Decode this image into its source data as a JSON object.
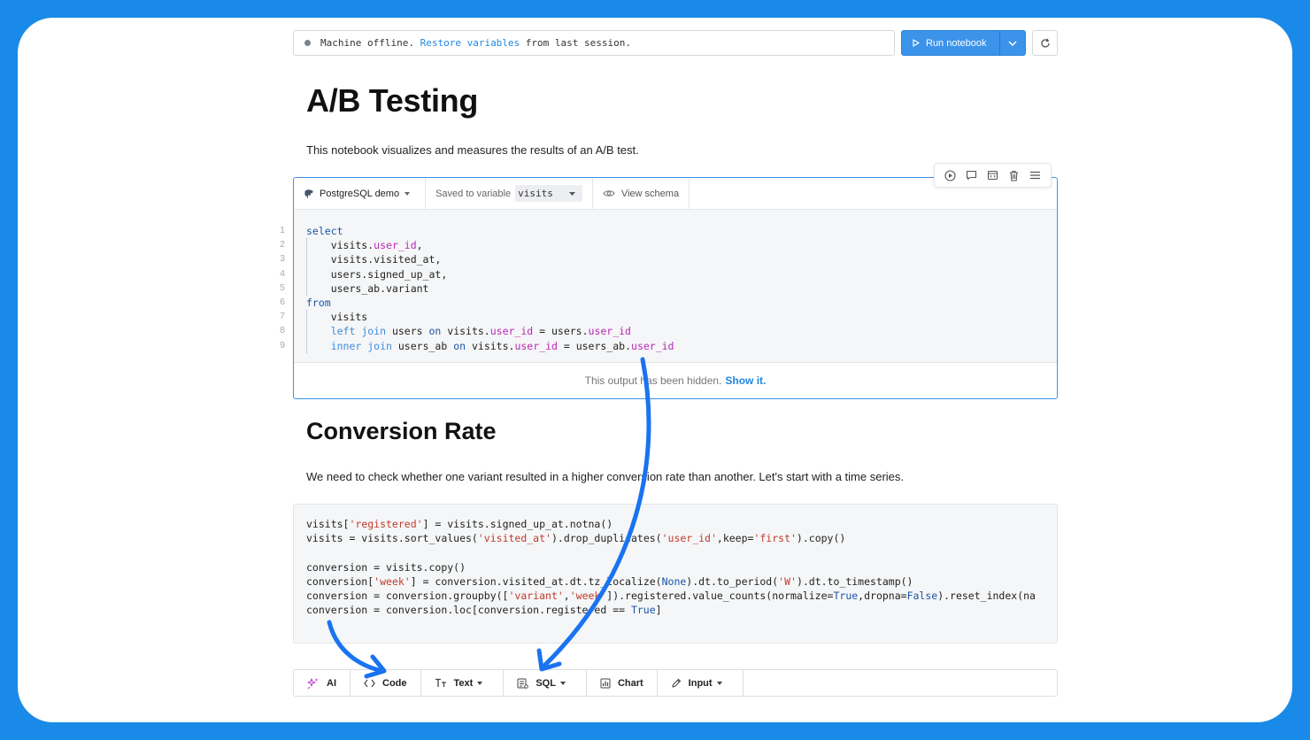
{
  "status_bar": {
    "prefix": "Machine offline. ",
    "link": "Restore variables",
    "suffix": " from last session."
  },
  "toolbar": {
    "run_label": "Run notebook"
  },
  "notebook": {
    "title": "A/B Testing",
    "intro": "This notebook visualizes and measures the results of an A/B test."
  },
  "sql_cell": {
    "datasource": "PostgreSQL demo",
    "saved_label": "Saved to variable",
    "variable": "visits",
    "schema_label": "View schema",
    "line_numbers": [
      "1",
      "2",
      "3",
      "4",
      "5",
      "6",
      "7",
      "8",
      "9"
    ],
    "output_hidden": "This output has been hidden.",
    "show_label": "Show it."
  },
  "section": {
    "heading": "Conversion Rate",
    "description": "We need to check whether one variant resulted in a higher conversion rate than another. Let's start with a time series."
  },
  "add_bar": {
    "ai": "AI",
    "code": "Code",
    "text": "Text",
    "sql": "SQL",
    "chart": "Chart",
    "input": "Input"
  },
  "colors": {
    "accent": "#1f87e5",
    "background": "#1a8ae8",
    "arrow": "#1a73f0"
  }
}
